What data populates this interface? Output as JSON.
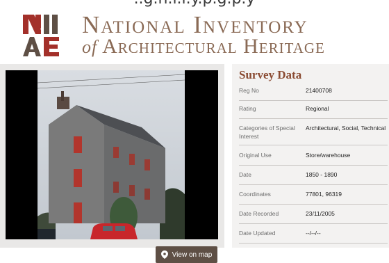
{
  "page": {
    "cut_tagline": "..g.n.l.l.y.p.g.p.y",
    "logo": {
      "title": "National Inventory",
      "sub_of": "of",
      "sub_rest": "Architectural Heritage",
      "colors": {
        "brown": "#8a6a55",
        "red": "#a3302a",
        "dark": "#5e4f45"
      }
    }
  },
  "photo": {
    "button_label": "View on map",
    "icon": "map-pin-icon"
  },
  "survey": {
    "title": "Survey Data",
    "rows": [
      {
        "key": "Reg No",
        "value": "21400708"
      },
      {
        "key": "Rating",
        "value": "Regional"
      },
      {
        "key": "Categories of Special Interest",
        "value": "Architectural, Social, Technical"
      },
      {
        "key": "Original Use",
        "value": "Store/warehouse"
      },
      {
        "key": "Date",
        "value": "1850 - 1890"
      },
      {
        "key": "Coordinates",
        "value": "77801, 96319"
      },
      {
        "key": "Date Recorded",
        "value": "23/11/2005"
      },
      {
        "key": "Date Updated",
        "value": "--/--/--"
      }
    ]
  }
}
